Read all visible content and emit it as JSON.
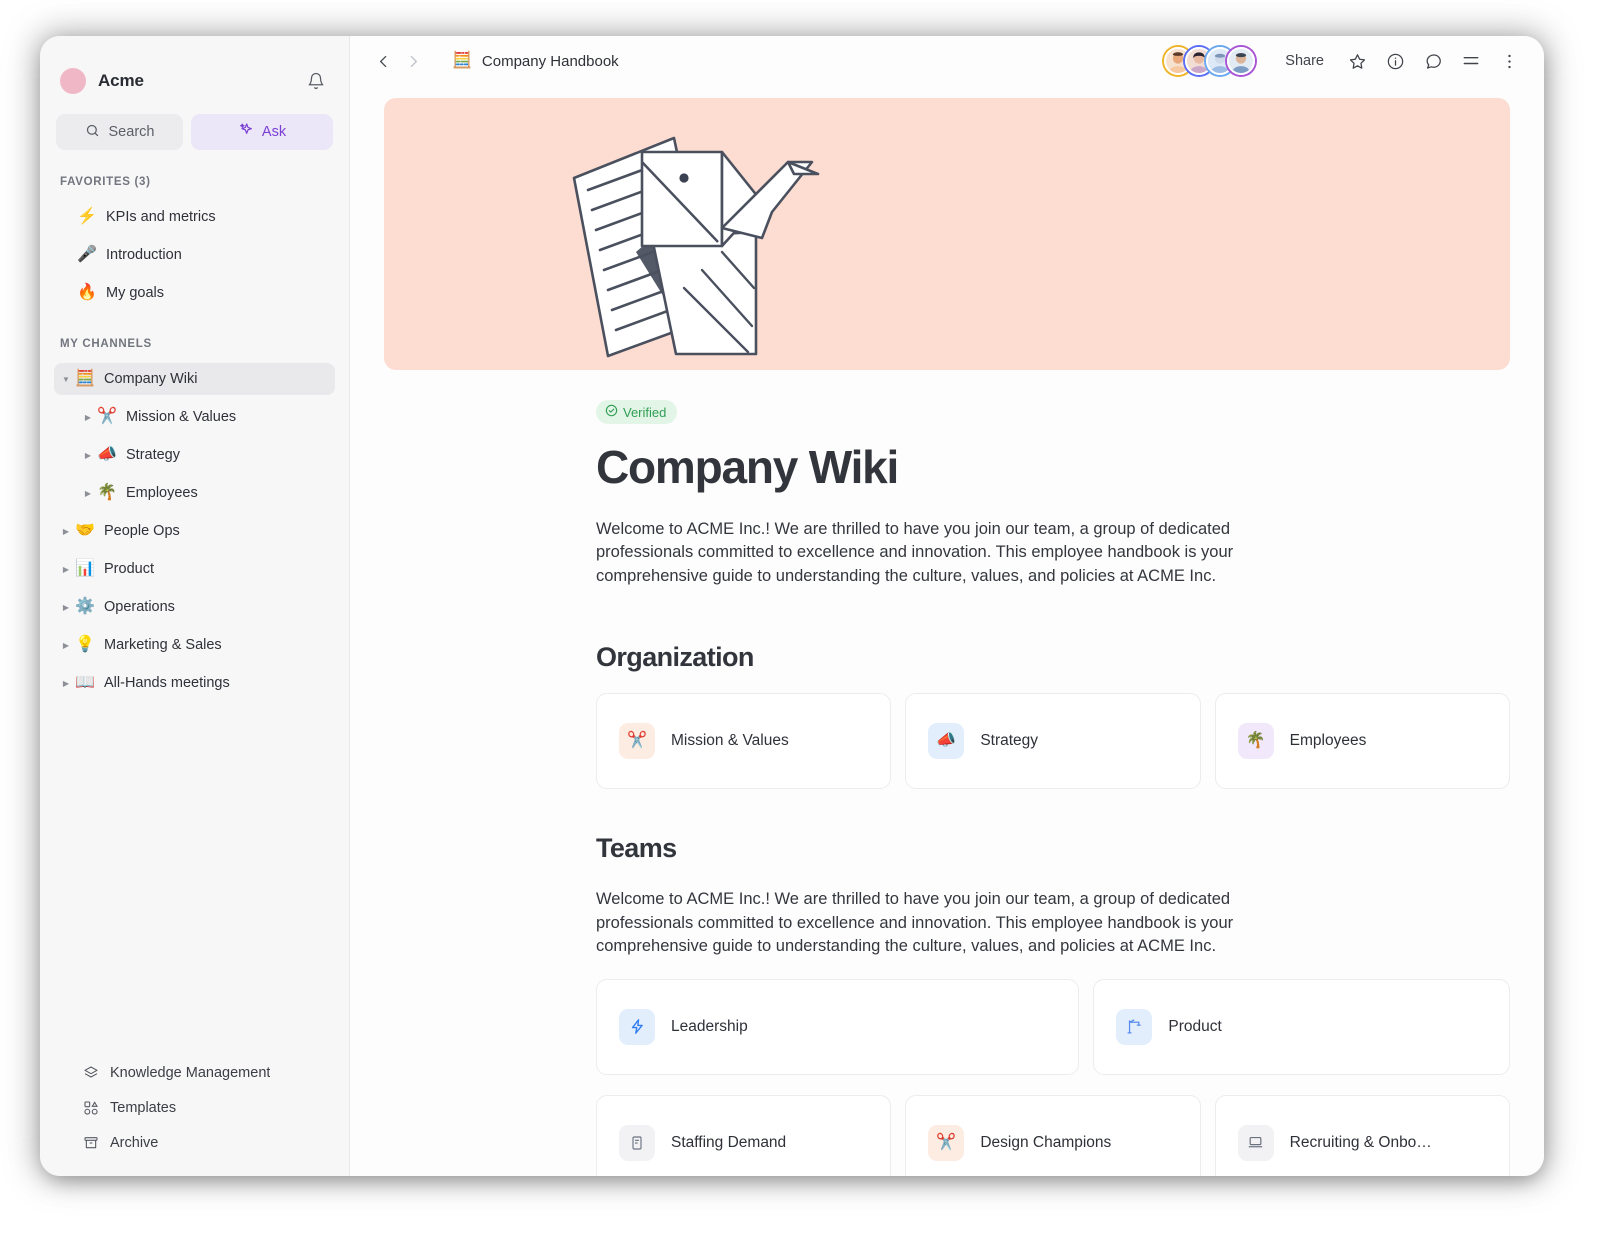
{
  "sidebar": {
    "workspace": {
      "name": "Acme",
      "avatar_color": "#f0b7c6"
    },
    "notifications_icon": "bell-icon",
    "search": {
      "label": "Search",
      "placeholder": "Search"
    },
    "ask": {
      "label": "Ask"
    },
    "favorites": {
      "label": "FAVORITES (3)",
      "items": [
        {
          "label": "KPIs and metrics",
          "icon": "lightning-bolt-icon",
          "color": "#e8910f"
        },
        {
          "label": "Introduction",
          "icon": "microphone-icon",
          "color": "#9b4fd6"
        },
        {
          "label": "My goals",
          "icon": "fire-icon",
          "color": "#e8601f"
        }
      ]
    },
    "channels": {
      "label": "MY CHANNELS",
      "items": [
        {
          "label": "Company Wiki",
          "icon": "abacus-icon",
          "color": "#a855d6",
          "level": 0,
          "expanded": true,
          "active": true
        },
        {
          "label": "Mission & Values",
          "icon": "scissors-icon",
          "color": "#f26d22",
          "level": 1,
          "expanded": false,
          "active": false
        },
        {
          "label": "Strategy",
          "icon": "megaphone-icon",
          "color": "#3b82f6",
          "level": 1,
          "expanded": false,
          "active": false
        },
        {
          "label": "Employees",
          "icon": "palm-tree-icon",
          "color": "#a855d6",
          "level": 1,
          "expanded": false,
          "active": false
        },
        {
          "label": "People Ops",
          "icon": "handshake-icon",
          "color": "#f26d22",
          "level": 0,
          "expanded": false,
          "active": false
        },
        {
          "label": "Product",
          "icon": "bar-chart-icon",
          "color": "#3b82f6",
          "level": 0,
          "expanded": false,
          "active": false
        },
        {
          "label": "Operations",
          "icon": "gear-sun-icon",
          "color": "#e8910f",
          "level": 0,
          "expanded": false,
          "active": false
        },
        {
          "label": "Marketing & Sales",
          "icon": "lightbulb-icon",
          "color": "#a855d6",
          "level": 0,
          "expanded": false,
          "active": false
        },
        {
          "label": "All-Hands meetings",
          "icon": "open-book-icon",
          "color": "#3d9e95",
          "level": 0,
          "expanded": false,
          "active": false
        }
      ]
    },
    "footer_items": [
      {
        "label": "Knowledge Management",
        "icon": "layers-icon"
      },
      {
        "label": "Templates",
        "icon": "templates-grid-icon"
      },
      {
        "label": "Archive",
        "icon": "archive-box-icon"
      }
    ]
  },
  "topbar": {
    "back_icon": "chevron-left-icon",
    "forward_icon": "chevron-right-icon",
    "breadcrumb": {
      "label": "Company Handbook",
      "icon": "abacus-icon"
    },
    "avatars": [
      {
        "name": "avatar-1",
        "ring": "#f0b429",
        "skin": "#e8a87c",
        "hair": "#5b3a2a",
        "shirt": "#f6c9a0"
      },
      {
        "name": "avatar-2",
        "ring": "#5b6ef5",
        "skin": "#e8b9a0",
        "hair": "#2b2230",
        "shirt": "#caa6c9"
      },
      {
        "name": "avatar-3",
        "ring": "#6aa8f0",
        "skin": "#cfd9ea",
        "hair": "#7b94b8",
        "shirt": "#9cbce4"
      },
      {
        "name": "avatar-4",
        "ring": "#a855d6",
        "skin": "#dcb49a",
        "hair": "#3a4352",
        "shirt": "#7d9cc4"
      }
    ],
    "share_label": "Share",
    "icons": [
      {
        "name": "star-icon"
      },
      {
        "name": "info-icon"
      },
      {
        "name": "comment-icon"
      },
      {
        "name": "menu-lines-icon"
      },
      {
        "name": "more-vertical-icon"
      }
    ]
  },
  "banner": {
    "background_color": "#fdddd1",
    "illustration": "origami-elephant-with-papers"
  },
  "page": {
    "badge": {
      "label": "Verified",
      "icon": "check-circle-icon",
      "bg": "#e2f5e6",
      "color": "#2f9e54"
    },
    "title": "Company Wiki",
    "intro": "Welcome to ACME Inc.! We are thrilled to have you join our team, a group of dedicated professionals committed to excellence and innovation. This employee handbook is your comprehensive guide to understanding the culture, values, and policies at ACME Inc.",
    "organization": {
      "title": "Organization",
      "cards": [
        {
          "label": "Mission & Values",
          "icon": "scissors-icon",
          "icon_color": "#f26d22",
          "tile_bg": "#fdece2"
        },
        {
          "label": "Strategy",
          "icon": "megaphone-icon",
          "icon_color": "#3b82f6",
          "tile_bg": "#e3eefd"
        },
        {
          "label": "Employees",
          "icon": "palm-tree-icon",
          "icon_color": "#a855d6",
          "tile_bg": "#f1e9fb"
        }
      ]
    },
    "teams": {
      "title": "Teams",
      "intro": "Welcome to ACME Inc.! We are thrilled to have you join our team, a group of dedicated professionals committed to excellence and innovation. This employee handbook is your comprehensive guide to understanding the culture, values, and policies at ACME Inc.",
      "row1": [
        {
          "label": "Leadership",
          "icon": "lightning-bolt-icon",
          "icon_color": "#2f7df0",
          "tile_bg": "#e3eefd"
        },
        {
          "label": "Product",
          "icon": "crane-icon",
          "icon_color": "#5b8def",
          "tile_bg": "#e3eefd"
        }
      ],
      "row2": [
        {
          "label": "Staffing Demand",
          "icon": "document-icon",
          "icon_color": "#6b7280",
          "tile_bg": "#f2f2f4"
        },
        {
          "label": "Design Champions",
          "icon": "scissors-icon",
          "icon_color": "#f26d22",
          "tile_bg": "#fdece2"
        },
        {
          "label": "Recruiting & Onbo…",
          "icon": "laptop-icon",
          "icon_color": "#6b7280",
          "tile_bg": "#f2f2f4"
        }
      ]
    }
  }
}
